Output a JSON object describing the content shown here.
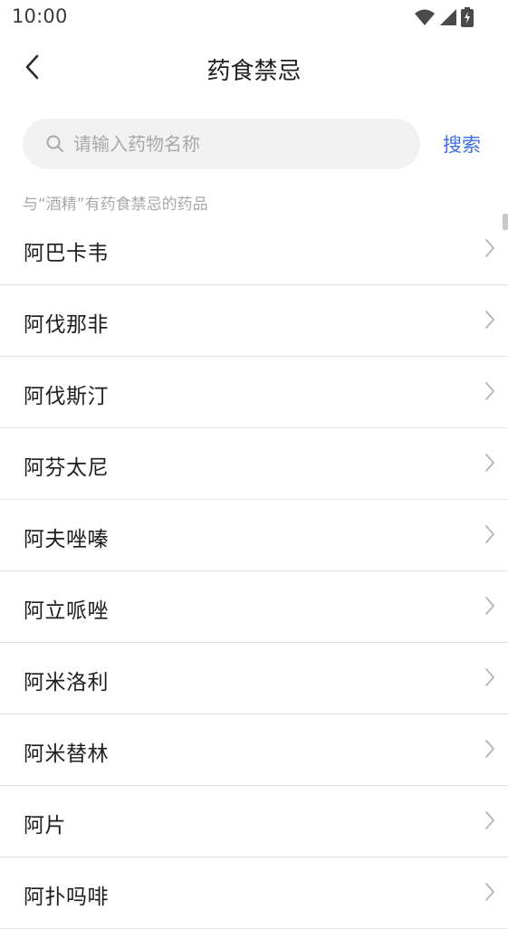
{
  "status_bar": {
    "time": "10:00",
    "icons": [
      "wifi-icon",
      "cellular-signal-icon",
      "battery-charging-icon"
    ]
  },
  "header": {
    "back_icon": "chevron-left-icon",
    "title": "药食禁忌"
  },
  "search": {
    "icon": "search-icon",
    "placeholder": "请输入药物名称",
    "value": "",
    "button_label": "搜索"
  },
  "caption": "与“酒精”有药食禁忌的药品",
  "drugs": [
    {
      "name": "阿巴卡韦"
    },
    {
      "name": "阿伐那非"
    },
    {
      "name": "阿伐斯汀"
    },
    {
      "name": "阿芬太尼"
    },
    {
      "name": "阿夫唑嗪"
    },
    {
      "name": "阿立哌唑"
    },
    {
      "name": "阿米洛利"
    },
    {
      "name": "阿米替林"
    },
    {
      "name": "阿片"
    },
    {
      "name": "阿扑吗啡"
    }
  ],
  "colors": {
    "accent": "#3f6fe0",
    "search_bg": "#f1f1f1",
    "divider": "#e4e4e4",
    "muted_text": "#a8a8a8"
  }
}
